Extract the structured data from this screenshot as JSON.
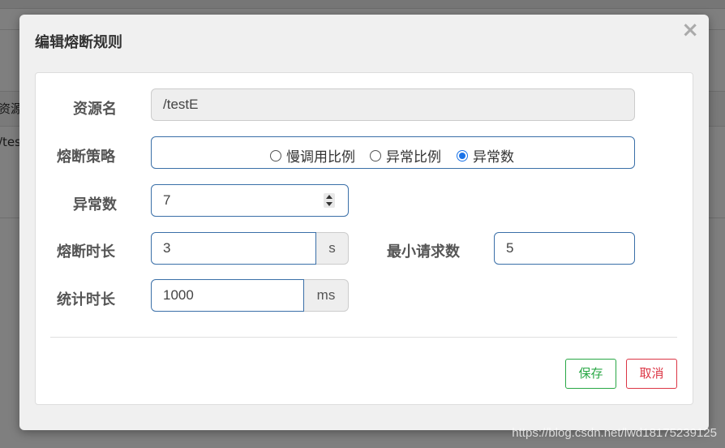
{
  "background": {
    "header_cell": "资源",
    "row_cell": "/test"
  },
  "modal": {
    "title": "编辑熔断规则",
    "close_icon": "×"
  },
  "form": {
    "resource": {
      "label": "资源名",
      "value": "/testE"
    },
    "strategy": {
      "label": "熔断策略",
      "options": [
        {
          "label": "慢调用比例",
          "checked": false
        },
        {
          "label": "异常比例",
          "checked": false
        },
        {
          "label": "异常数",
          "checked": true
        }
      ]
    },
    "exception_count": {
      "label": "异常数",
      "value": "7"
    },
    "break_duration": {
      "label": "熔断时长",
      "value": "3",
      "unit": "s"
    },
    "min_requests": {
      "label": "最小请求数",
      "value": "5"
    },
    "stat_duration": {
      "label": "统计时长",
      "value": "1000",
      "unit": "ms"
    }
  },
  "buttons": {
    "save": "保存",
    "cancel": "取消"
  },
  "colors": {
    "input_border": "#3a6fa8",
    "save": "#28a745",
    "cancel": "#dc3545",
    "radio_checked": "#1a73e8"
  },
  "watermark": "https://blog.csdn.net/lwd18175239125"
}
